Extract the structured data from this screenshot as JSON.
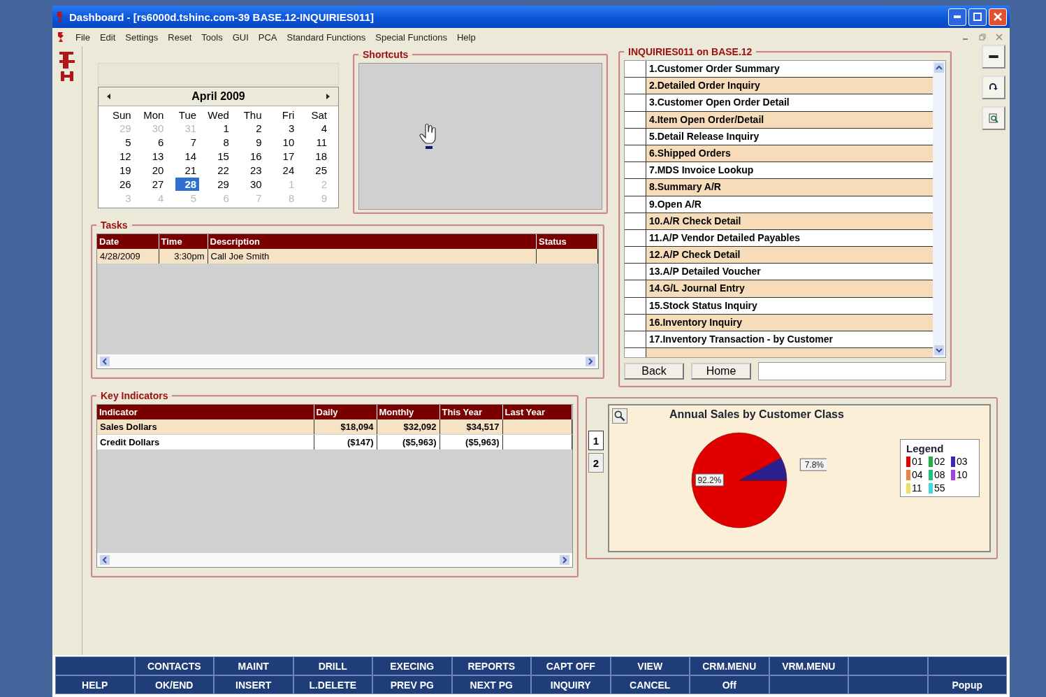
{
  "window": {
    "title": "Dashboard - [rs6000d.tshinc.com-39 BASE.12-INQUIRIES011]"
  },
  "menu": [
    "File",
    "Edit",
    "Settings",
    "Reset",
    "Tools",
    "GUI",
    "PCA",
    "Standard Functions",
    "Special Functions",
    "Help"
  ],
  "calendar": {
    "month": "April 2009",
    "weekdays": [
      "Sun",
      "Mon",
      "Tue",
      "Wed",
      "Thu",
      "Fri",
      "Sat"
    ],
    "weeks": [
      [
        {
          "day": "29",
          "muted": true,
          "selected": false
        },
        {
          "day": "30",
          "muted": true,
          "selected": false
        },
        {
          "day": "31",
          "muted": true,
          "selected": false
        },
        {
          "day": "1",
          "muted": false,
          "selected": false
        },
        {
          "day": "2",
          "muted": false,
          "selected": false
        },
        {
          "day": "3",
          "muted": false,
          "selected": false
        },
        {
          "day": "4",
          "muted": false,
          "selected": false
        }
      ],
      [
        {
          "day": "5",
          "muted": false,
          "selected": false
        },
        {
          "day": "6",
          "muted": false,
          "selected": false
        },
        {
          "day": "7",
          "muted": false,
          "selected": false
        },
        {
          "day": "8",
          "muted": false,
          "selected": false
        },
        {
          "day": "9",
          "muted": false,
          "selected": false
        },
        {
          "day": "10",
          "muted": false,
          "selected": false
        },
        {
          "day": "11",
          "muted": false,
          "selected": false
        }
      ],
      [
        {
          "day": "12",
          "muted": false,
          "selected": false
        },
        {
          "day": "13",
          "muted": false,
          "selected": false
        },
        {
          "day": "14",
          "muted": false,
          "selected": false
        },
        {
          "day": "15",
          "muted": false,
          "selected": false
        },
        {
          "day": "16",
          "muted": false,
          "selected": false
        },
        {
          "day": "17",
          "muted": false,
          "selected": false
        },
        {
          "day": "18",
          "muted": false,
          "selected": false
        }
      ],
      [
        {
          "day": "19",
          "muted": false,
          "selected": false
        },
        {
          "day": "20",
          "muted": false,
          "selected": false
        },
        {
          "day": "21",
          "muted": false,
          "selected": false
        },
        {
          "day": "22",
          "muted": false,
          "selected": false
        },
        {
          "day": "23",
          "muted": false,
          "selected": false
        },
        {
          "day": "24",
          "muted": false,
          "selected": false
        },
        {
          "day": "25",
          "muted": false,
          "selected": false
        }
      ],
      [
        {
          "day": "26",
          "muted": false,
          "selected": false
        },
        {
          "day": "27",
          "muted": false,
          "selected": false
        },
        {
          "day": "28",
          "muted": false,
          "selected": true
        },
        {
          "day": "29",
          "muted": false,
          "selected": false
        },
        {
          "day": "30",
          "muted": false,
          "selected": false
        },
        {
          "day": "1",
          "muted": true,
          "selected": false
        },
        {
          "day": "2",
          "muted": true,
          "selected": false
        }
      ],
      [
        {
          "day": "3",
          "muted": true,
          "selected": false
        },
        {
          "day": "4",
          "muted": true,
          "selected": false
        },
        {
          "day": "5",
          "muted": true,
          "selected": false
        },
        {
          "day": "6",
          "muted": true,
          "selected": false
        },
        {
          "day": "7",
          "muted": true,
          "selected": false
        },
        {
          "day": "8",
          "muted": true,
          "selected": false
        },
        {
          "day": "9",
          "muted": true,
          "selected": false
        }
      ]
    ]
  },
  "shortcuts": {
    "title": "Shortcuts"
  },
  "tasks": {
    "title": "Tasks",
    "columns": [
      "Date",
      "Time",
      "Description",
      "Status"
    ],
    "rows": [
      [
        "4/28/2009",
        "3:30pm",
        "Call Joe Smith"
      ]
    ]
  },
  "inquiries": {
    "title": "INQUIRIES011 on BASE.12",
    "items": [
      "1.Customer Order Summary",
      "2.Detailed Order Inquiry",
      "3.Customer Open Order Detail",
      "4.Item Open Order/Detail",
      "5.Detail Release Inquiry",
      "6.Shipped Orders",
      "7.MDS Invoice Lookup",
      "8.Summary A/R",
      "9.Open A/R",
      "10.A/R Check Detail",
      "11.A/P Vendor Detailed Payables",
      "12.A/P Check Detail",
      "13.A/P Detailed Voucher",
      "14.G/L Journal Entry",
      "15.Stock Status Inquiry",
      "16.Inventory Inquiry",
      "17.Inventory Transaction - by Customer"
    ],
    "buttons": [
      "Back",
      "Home"
    ]
  },
  "key_indicators": {
    "title": "Key Indicators",
    "columns": [
      "Indicator",
      "Daily",
      "Monthly",
      "This Year",
      "Last Year"
    ],
    "rows": [
      [
        "Sales Dollars",
        "$18,094",
        "$32,092",
        "$34,517"
      ],
      [
        "Credit Dollars",
        "($147)",
        "($5,963)",
        "($5,963)"
      ]
    ]
  },
  "chart_panel": {
    "tabs": [
      {
        "label": "1",
        "selected": true
      },
      {
        "label": "2",
        "selected": false
      }
    ],
    "chart_data": {
      "type": "pie",
      "title": "Annual Sales by Customer Class",
      "values": [
        92.2,
        7.8
      ],
      "colors": [
        "#e00000",
        "#2a2090"
      ],
      "value_labels": [
        "92.2%",
        "7.8%"
      ]
    },
    "legend": {
      "title": "Legend",
      "items": [
        {
          "label": "01",
          "color": "#e00000"
        },
        {
          "label": "02",
          "color": "#20b040"
        },
        {
          "label": "03",
          "color": "#4020c0"
        },
        {
          "label": "04",
          "color": "#f08040"
        },
        {
          "label": "08",
          "color": "#20c080"
        },
        {
          "label": "10",
          "color": "#a040e0"
        },
        {
          "label": "11",
          "color": "#f0e060"
        },
        {
          "label": "55",
          "color": "#40d8e0"
        }
      ]
    }
  },
  "function_keys": [
    [
      {
        "kind": "blank"
      },
      {
        "kind": "key",
        "label": "CONTACTS"
      },
      {
        "kind": "key",
        "label": "MAINT"
      },
      {
        "kind": "key",
        "label": "DRILL"
      },
      {
        "kind": "key",
        "label": "EXECING"
      },
      {
        "kind": "key",
        "label": "REPORTS"
      },
      {
        "kind": "key",
        "label": "CAPT OFF"
      },
      {
        "kind": "key",
        "label": "VIEW"
      },
      {
        "kind": "key",
        "label": "CRM.MENU"
      },
      {
        "kind": "key",
        "label": "VRM.MENU"
      },
      {
        "kind": "blank"
      },
      {
        "kind": "blank"
      }
    ],
    [
      {
        "kind": "key",
        "label": "HELP"
      },
      {
        "kind": "key",
        "label": "OK/END"
      },
      {
        "kind": "key",
        "label": "INSERT"
      },
      {
        "kind": "key",
        "label": "L.DELETE"
      },
      {
        "kind": "key",
        "label": "PREV PG"
      },
      {
        "kind": "key",
        "label": "NEXT PG"
      },
      {
        "kind": "key",
        "label": "INQUIRY"
      },
      {
        "kind": "key",
        "label": "CANCEL"
      },
      {
        "kind": "key",
        "label": "Off"
      },
      {
        "kind": "blank"
      },
      {
        "kind": "blank"
      },
      {
        "kind": "key",
        "label": "Popup"
      }
    ]
  ]
}
